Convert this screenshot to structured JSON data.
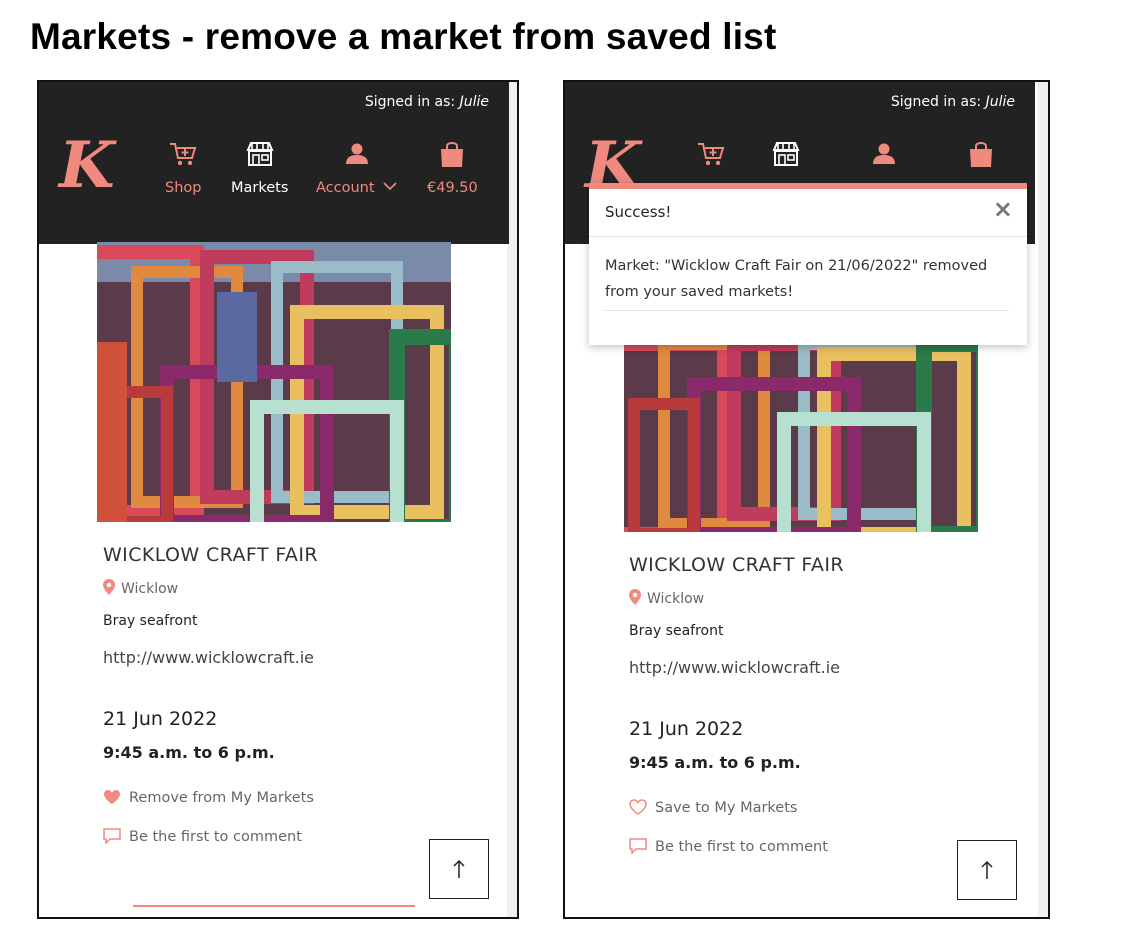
{
  "heading": "Markets - remove a market from saved list",
  "colors": {
    "accent": "#f08a7e",
    "navbar": "#222222"
  },
  "navbar": {
    "signed_in_prefix": "Signed in as: ",
    "username": "Julie",
    "logo": "K",
    "items": [
      {
        "label": "Shop",
        "icon": "cart-plus-icon"
      },
      {
        "label": "Markets",
        "icon": "storefront-icon"
      },
      {
        "label": "Account",
        "icon": "user-icon"
      },
      {
        "label": "€49.50",
        "icon": "shopping-bag-icon"
      }
    ]
  },
  "market": {
    "title": "WICKLOW CRAFT FAIR",
    "location": "Wicklow",
    "venue": "Bray seafront",
    "website": "http://www.wicklowcraft.ie",
    "date": "21 Jun 2022",
    "time": "9:45 a.m. to 6 p.m.",
    "comment_label": "Be the first to comment"
  },
  "left_screen": {
    "saved_action": "Remove from My Markets",
    "saved": true
  },
  "right_screen": {
    "saved_action": "Save to My Markets",
    "saved": false,
    "toast": {
      "title": "Success!",
      "close": "×",
      "message": "Market: \"Wicklow Craft Fair on 21/06/2022\" removed from your saved markets!"
    }
  },
  "back_to_top_icon": "arrow-up-icon"
}
